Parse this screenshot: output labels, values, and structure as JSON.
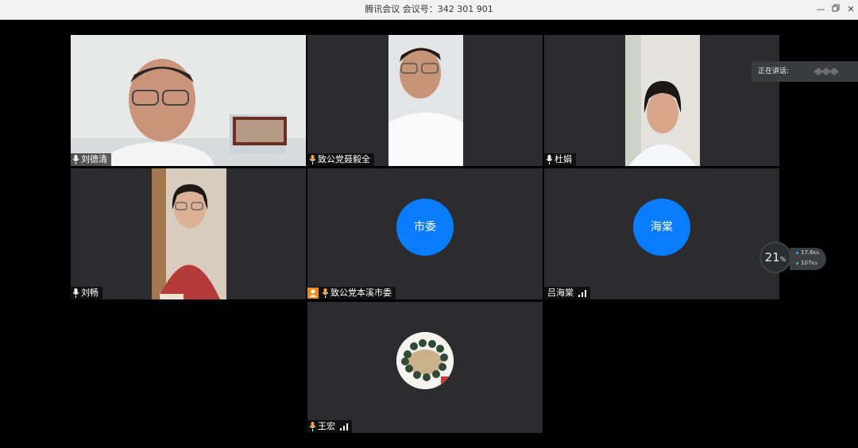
{
  "window": {
    "title": "腾讯会议 会议号：342 301 901",
    "minimize_icon": "minimize-icon",
    "restore_icon": "restore-icon",
    "close_icon": "close-icon"
  },
  "participants": [
    {
      "name": "刘德清",
      "video": true,
      "muted": true
    },
    {
      "name": "致公党聂毅全",
      "video": true,
      "muted": true
    },
    {
      "name": "杜娟",
      "video": true,
      "muted": true
    },
    {
      "name": "刘畅",
      "video": true,
      "muted": true
    },
    {
      "name": "致公党本溪市委",
      "avatar_text": "市委",
      "host": true,
      "muted": true
    },
    {
      "name": "吕海棠",
      "avatar_text": "海棠",
      "signal": true
    },
    {
      "name": "王宏",
      "avatar": "bracelet-photo",
      "muted": true,
      "signal": true
    }
  ],
  "speaking": {
    "label": "正在讲话:"
  },
  "network": {
    "quality_value": "21",
    "quality_unit": "%",
    "upload_rate": "17.6",
    "upload_unit": "K/s",
    "download_rate": "107",
    "download_unit": "K/s",
    "upload_color": "#3ea0ff",
    "download_color": "#38c172"
  },
  "colors": {
    "avatar_blue": "#0a7cff",
    "tile_bg": "#2c2c2e",
    "host_badge": "#f08c1e"
  }
}
